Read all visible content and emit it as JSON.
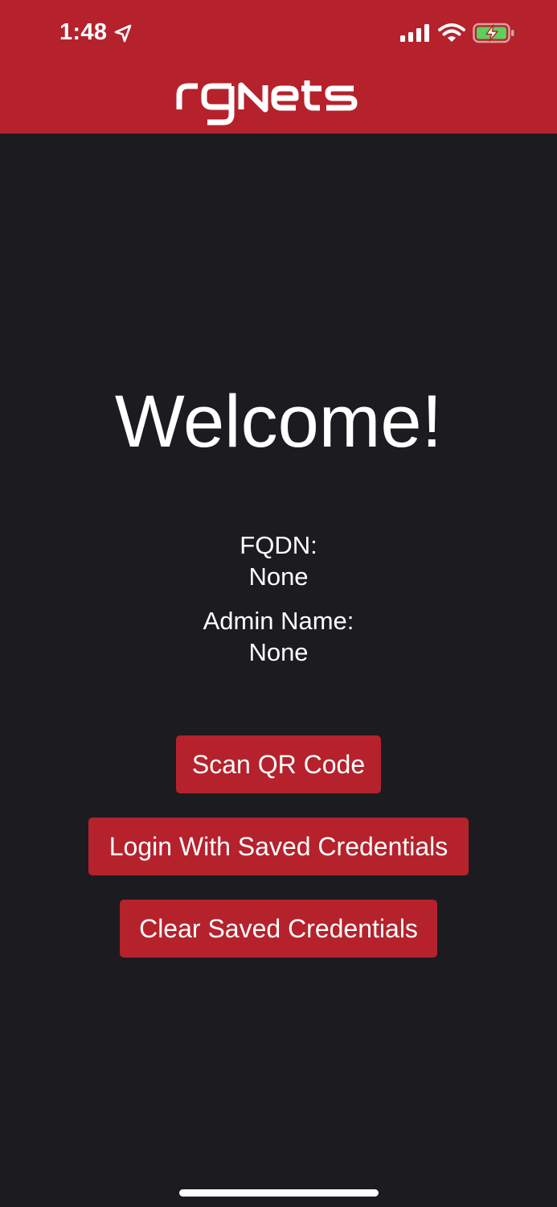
{
  "status_bar": {
    "time": "1:48"
  },
  "header": {
    "logo_text": "rgNets",
    "background_color": "#b5222c"
  },
  "main": {
    "welcome_title": "Welcome!",
    "fqdn_label": "FQDN:",
    "fqdn_value": "None",
    "admin_label": "Admin Name:",
    "admin_value": "None"
  },
  "buttons": {
    "scan_qr": "Scan QR Code",
    "login_saved": "Login With Saved Credentials",
    "clear_saved": "Clear Saved Credentials"
  },
  "colors": {
    "accent": "#b5222c",
    "background": "#1c1b20",
    "text": "#ffffff"
  },
  "icons": [
    "location-arrow-icon",
    "cellular-signal-icon",
    "wifi-icon",
    "battery-charging-icon"
  ]
}
